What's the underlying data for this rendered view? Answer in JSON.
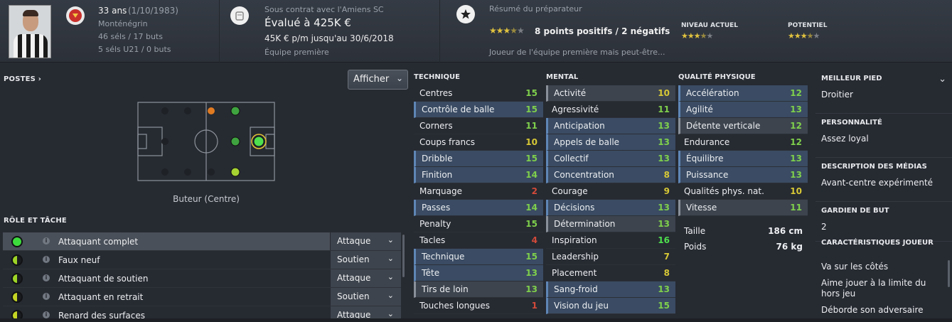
{
  "header": {
    "age": "33 ans",
    "dob": "(1/10/1983)",
    "nationality": "Monténégrin",
    "caps": "46 séls / 17 buts",
    "u21_caps": "5 séls U21 / 0 buts",
    "contract": "Sous contrat avec l'Amiens SC",
    "value": "Évalué à 425K €",
    "wage": "45K € p/m jusqu'au 30/6/2018",
    "squad_status": "Équipe première",
    "scout_title": "Résumé du préparateur",
    "scout_points": "8 points positifs / 2 négatifs",
    "scout_rating_stars": 3.5,
    "scout_summary": "Joueur de l'équipe première mais peut-être...",
    "current_ability_label": "NIVEAU ACTUEL",
    "current_ability_stars": 3.5,
    "potential_label": "POTENTIEL",
    "potential_stars": 3.5
  },
  "positions": {
    "label": "POSTES",
    "dropdown": "Afficher",
    "position_label": "Buteur (Centre)"
  },
  "roles": {
    "label": "RÔLE ET TÂCHE",
    "items": [
      {
        "name": "Attaquant complet",
        "duty": "Attaque",
        "color": "#3ddc3d",
        "fit": "full",
        "selected": true
      },
      {
        "name": "Faux neuf",
        "duty": "Soutien",
        "color": "#9ed426",
        "fit": "half"
      },
      {
        "name": "Attaquant de soutien",
        "duty": "Attaque",
        "color": "#9ed426",
        "fit": "half"
      },
      {
        "name": "Attaquant en retrait",
        "duty": "Soutien",
        "color": "#c4d424",
        "fit": "half"
      },
      {
        "name": "Renard des surfaces",
        "duty": "Attaque",
        "color": "#c4d424",
        "fit": "half"
      }
    ]
  },
  "colors": {
    "green": "#7fd04c",
    "yellow": "#d7c836",
    "red": "#d44a3a",
    "bright_green": "#4ee04e"
  },
  "attributes": {
    "technique": {
      "label": "TECHNIQUE",
      "items": [
        {
          "name": "Centres",
          "value": "15",
          "hl": ""
        },
        {
          "name": "Contrôle de balle",
          "value": "15",
          "hl": "hl"
        },
        {
          "name": "Corners",
          "value": "11",
          "hl": ""
        },
        {
          "name": "Coups francs",
          "value": "10",
          "hl": ""
        },
        {
          "name": "Dribble",
          "value": "15",
          "hl": "hl"
        },
        {
          "name": "Finition",
          "value": "14",
          "hl": "hl"
        },
        {
          "name": "Marquage",
          "value": "2",
          "hl": ""
        },
        {
          "name": "Passes",
          "value": "14",
          "hl": "hl"
        },
        {
          "name": "Penalty",
          "value": "15",
          "hl": ""
        },
        {
          "name": "Tacles",
          "value": "4",
          "hl": ""
        },
        {
          "name": "Technique",
          "value": "15",
          "hl": "hl"
        },
        {
          "name": "Tête",
          "value": "13",
          "hl": "hl"
        },
        {
          "name": "Tirs de loin",
          "value": "13",
          "hl": "hl2"
        },
        {
          "name": "Touches longues",
          "value": "1",
          "hl": ""
        }
      ]
    },
    "mental": {
      "label": "MENTAL",
      "items": [
        {
          "name": "Activité",
          "value": "10",
          "hl": "hl2"
        },
        {
          "name": "Agressivité",
          "value": "11",
          "hl": ""
        },
        {
          "name": "Anticipation",
          "value": "13",
          "hl": "hl"
        },
        {
          "name": "Appels de balle",
          "value": "13",
          "hl": "hl"
        },
        {
          "name": "Collectif",
          "value": "13",
          "hl": "hl"
        },
        {
          "name": "Concentration",
          "value": "8",
          "hl": "hl"
        },
        {
          "name": "Courage",
          "value": "9",
          "hl": ""
        },
        {
          "name": "Décisions",
          "value": "13",
          "hl": "hl"
        },
        {
          "name": "Détermination",
          "value": "13",
          "hl": "hl2"
        },
        {
          "name": "Inspiration",
          "value": "16",
          "hl": ""
        },
        {
          "name": "Leadership",
          "value": "7",
          "hl": ""
        },
        {
          "name": "Placement",
          "value": "8",
          "hl": ""
        },
        {
          "name": "Sang-froid",
          "value": "13",
          "hl": "hl"
        },
        {
          "name": "Vision du jeu",
          "value": "15",
          "hl": "hl"
        }
      ]
    },
    "physical": {
      "label": "QUALITÉ PHYSIQUE",
      "items": [
        {
          "name": "Accélération",
          "value": "12",
          "hl": "hl"
        },
        {
          "name": "Agilité",
          "value": "13",
          "hl": "hl"
        },
        {
          "name": "Détente verticale",
          "value": "12",
          "hl": "hl2"
        },
        {
          "name": "Endurance",
          "value": "12",
          "hl": ""
        },
        {
          "name": "Équilibre",
          "value": "13",
          "hl": "hl"
        },
        {
          "name": "Puissance",
          "value": "13",
          "hl": "hl"
        },
        {
          "name": "Qualités phys. nat.",
          "value": "10",
          "hl": ""
        },
        {
          "name": "Vitesse",
          "value": "11",
          "hl": "hl2"
        }
      ],
      "height_label": "Taille",
      "height": "186 cm",
      "weight_label": "Poids",
      "weight": "76 kg"
    }
  },
  "info": {
    "best_foot_label": "MEILLEUR PIED",
    "best_foot": "Droitier",
    "personality_label": "PERSONNALITÉ",
    "personality": "Assez loyal",
    "media_label": "DESCRIPTION DES MÉDIAS",
    "media": "Avant-centre expérimenté",
    "goalkeeper_label": "GARDIEN DE BUT",
    "goalkeeper": "2",
    "traits_label": "CARACTÉRISTIQUES JOUEUR",
    "traits": [
      "Va sur les côtés",
      "Aime jouer à la limite du hors jeu",
      "Déborde son adversaire"
    ]
  }
}
